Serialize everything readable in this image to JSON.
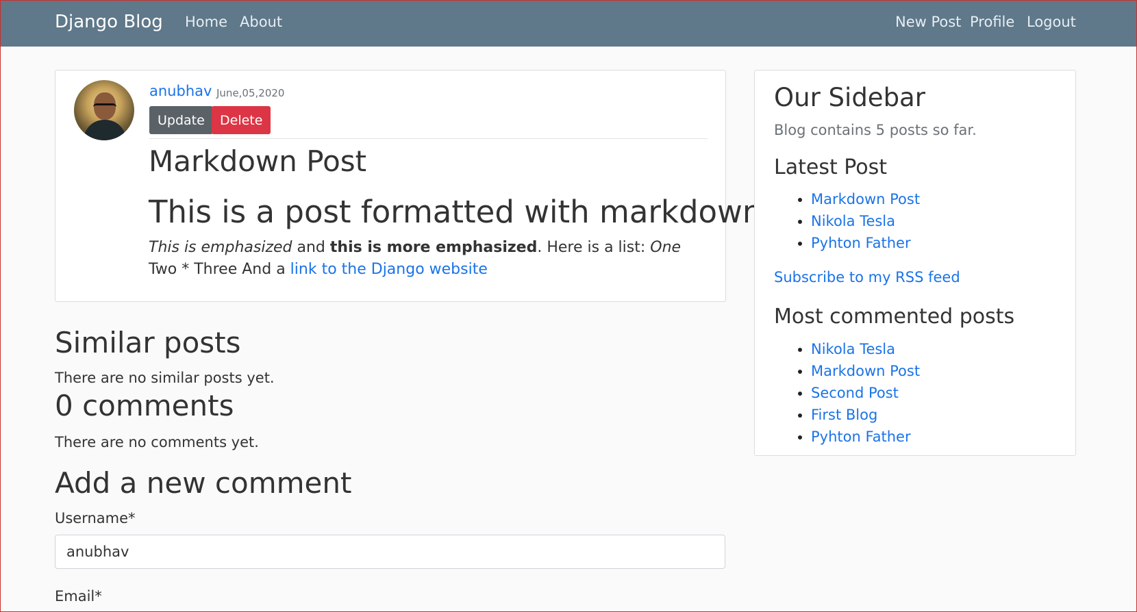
{
  "nav": {
    "brand": "Django Blog",
    "left": [
      "Home",
      "About"
    ],
    "right": [
      "New Post",
      "Profile",
      "Logout"
    ]
  },
  "post": {
    "author": "anubhav",
    "date": "June,05,2020",
    "update_label": "Update",
    "delete_label": "Delete",
    "title": "Markdown Post",
    "subtitle": "This is a post formatted with markdown",
    "body": {
      "em": "This is emphasized",
      "and": " and ",
      "strong": "this is more emphasized",
      "rest1": ". Here is a list: ",
      "em2": "One",
      "rest2": " Two * Three And a ",
      "link": "link to the Django website"
    }
  },
  "similar": {
    "title": "Similar posts",
    "text": "There are no similar posts yet."
  },
  "comments": {
    "title": "0 comments",
    "text": "There are no comments yet."
  },
  "form": {
    "title": "Add a new comment",
    "username_label": "Username*",
    "username_value": "anubhav",
    "email_label": "Email*"
  },
  "sidebar": {
    "title": "Our Sidebar",
    "subtitle": "Blog contains 5 posts so far.",
    "latest_title": "Latest Post",
    "latest": [
      "Markdown Post",
      "Nikola Tesla",
      "Pyhton Father"
    ],
    "rss": "Subscribe to my RSS feed",
    "most_title": "Most commented posts",
    "most": [
      "Nikola Tesla",
      "Markdown Post",
      "Second Post",
      "First Blog",
      "Pyhton Father"
    ]
  },
  "colors": {
    "navbar": "#5f788a",
    "update_btn": "#5a6268",
    "delete_btn": "#dc3545",
    "link": "#1a73e8"
  }
}
